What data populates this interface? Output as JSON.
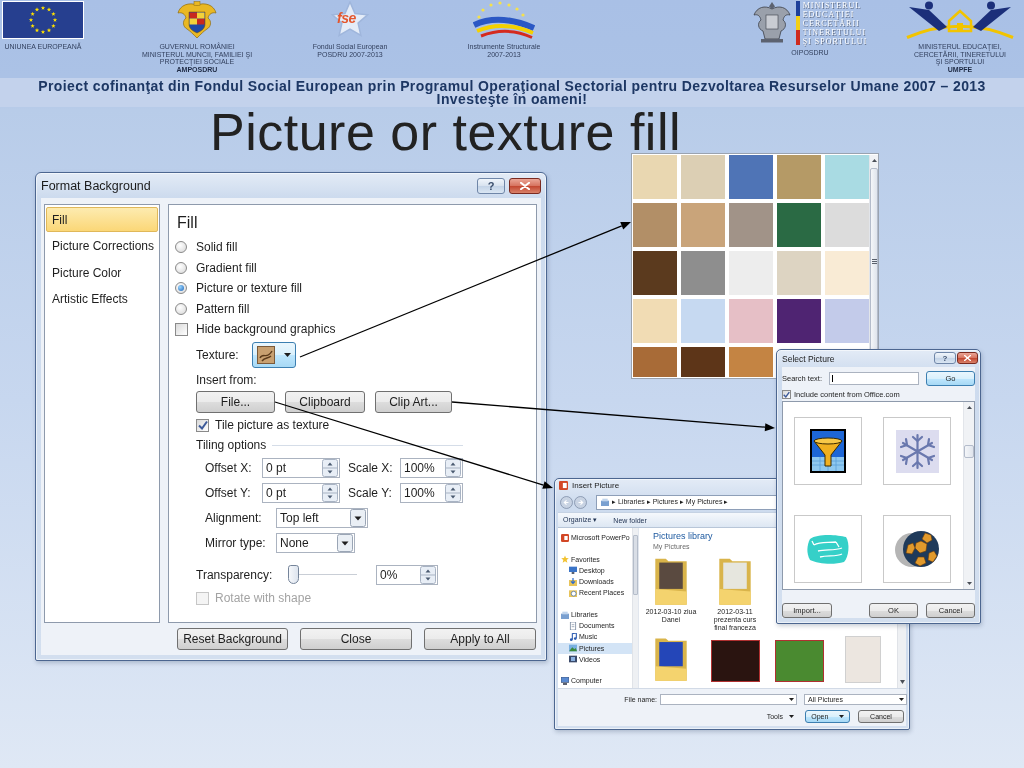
{
  "header": {
    "logos": [
      {
        "kind": "eu-flag",
        "caption": [
          "UNIUNEA EUROPEANĂ"
        ]
      },
      {
        "kind": "coat-of-arms",
        "caption": [
          "GUVERNUL ROMÂNIEI",
          "MINISTERUL MUNCII, FAMILIEI ŞI",
          "PROTECŢIEI SOCIALE",
          "**AMPOSDRU**"
        ]
      },
      {
        "kind": "fse-star",
        "mark": "fse",
        "caption": [
          "Fondul Social European",
          "POSDRU 2007-2013"
        ]
      },
      {
        "kind": "structural-instruments",
        "caption": [
          "Instrumente Structurale",
          "2007-2013"
        ]
      },
      {
        "kind": "ministry-eagle",
        "mark_lines": [
          "MINISTERUL",
          "EDUCAŢIEI",
          "CERCETĂRII",
          "TINERETULUI",
          "ŞI SPORTULUI"
        ],
        "caption": [
          "OIPOSDRU"
        ]
      },
      {
        "kind": "umpfe-house",
        "caption": [
          "MINISTERUL EDUCAŢIEI,",
          "CERCETĂRII, TINERETULUI",
          "ŞI SPORTULUI",
          "**UMPFE**"
        ]
      }
    ]
  },
  "banner": {
    "text": "Proiect cofinanţat din Fondul Social European prin Programul Operaţional Sectorial pentru Dezvoltarea Resurselor Umane 2007 – 2013",
    "slogan": "Investeşte în oameni!"
  },
  "title": "Picture or texture fill",
  "format_background": {
    "title": "Format Background",
    "help": "?",
    "categories": [
      {
        "label": "Fill",
        "selected": true
      },
      {
        "label": "Picture Corrections",
        "selected": false
      },
      {
        "label": "Picture Color",
        "selected": false
      },
      {
        "label": "Artistic Effects",
        "selected": false
      }
    ],
    "heading": "Fill",
    "fill_options": [
      {
        "label": "Solid fill",
        "selected": false
      },
      {
        "label": "Gradient fill",
        "selected": false
      },
      {
        "label": "Picture or texture fill",
        "selected": true
      },
      {
        "label": "Pattern fill",
        "selected": false
      }
    ],
    "hide_background_graphics": {
      "label": "Hide background graphics",
      "checked": false
    },
    "texture": {
      "label": "Texture:"
    },
    "insert_from": {
      "label": "Insert from:",
      "buttons": [
        "File...",
        "Clipboard",
        "Clip Art..."
      ]
    },
    "tile_as_texture": {
      "label": "Tile picture as texture",
      "checked": true
    },
    "tiling_options": {
      "label": "Tiling options",
      "fields": [
        {
          "label": "Offset X:",
          "value": "0 pt"
        },
        {
          "label": "Scale X:",
          "value": "100%"
        },
        {
          "label": "Offset Y:",
          "value": "0 pt"
        },
        {
          "label": "Scale Y:",
          "value": "100%"
        }
      ],
      "dropdowns": [
        {
          "label": "Alignment:",
          "value": "Top left"
        },
        {
          "label": "Mirror type:",
          "value": "None"
        }
      ]
    },
    "transparency": {
      "label": "Transparency:",
      "level": 0,
      "value": "0%"
    },
    "rotate_with_shape": {
      "label": "Rotate with shape",
      "checked": false,
      "disabled": true
    },
    "buttons": [
      "Reset Background",
      "Close",
      "Apply to All"
    ]
  },
  "texture_gallery": {
    "tiles": [
      {
        "color": "#e9d7b1"
      },
      {
        "color": "#dccfb4"
      },
      {
        "color": "#4f74b6"
      },
      {
        "color": "#b59a66"
      },
      {
        "color": "#a9dbe3"
      },
      {
        "color": "#b28f67"
      },
      {
        "color": "#c9a47a"
      },
      {
        "color": "#a19388"
      },
      {
        "color": "#2a6a44"
      },
      {
        "color": "#dcdcdc"
      },
      {
        "color": "#5b3a1e"
      },
      {
        "color": "#8e8e8e"
      },
      {
        "color": "#ededed"
      },
      {
        "color": "#ddd4c2"
      },
      {
        "color": "#f9ebd5"
      },
      {
        "color": "#f1dcb4"
      },
      {
        "color": "#c6d9f1"
      },
      {
        "color": "#e6bfc6"
      },
      {
        "color": "#4f2472"
      },
      {
        "color": "#c3cbea"
      },
      {
        "color": "#a86b37"
      },
      {
        "color": "#5d3518"
      },
      {
        "color": "#c48443"
      }
    ]
  },
  "select_picture": {
    "title": "Select Picture",
    "help": "?",
    "search_label": "Search text:",
    "go_button": {
      "label": "Go",
      "default": true
    },
    "include_office": {
      "label": "Include content from Office.com",
      "checked": true
    },
    "clips": [
      {
        "kind": "funnel"
      },
      {
        "kind": "snowflake"
      },
      {
        "kind": "hand"
      },
      {
        "kind": "ball"
      }
    ],
    "buttons": [
      "Import...",
      "OK",
      "Cancel"
    ]
  },
  "insert_picture": {
    "title": "Insert Picture",
    "breadcrumb": "▸ Libraries ▸ Pictures ▸ My Pictures ▸",
    "toolbar": [
      "Organize ▾",
      "New folder"
    ],
    "nav": [
      {
        "label": "Microsoft PowerPo",
        "kind": "app",
        "selected": false
      },
      {
        "label": "Favorites",
        "kind": "favorites",
        "selected": false,
        "children": [
          {
            "label": "Desktop",
            "kind": "desktop",
            "selected": false
          },
          {
            "label": "Downloads",
            "kind": "downloads",
            "selected": false
          },
          {
            "label": "Recent Places",
            "kind": "recent",
            "selected": false
          }
        ]
      },
      {
        "label": "Libraries",
        "kind": "libraries",
        "selected": false,
        "children": [
          {
            "label": "Documents",
            "kind": "documents",
            "selected": false
          },
          {
            "label": "Music",
            "kind": "music",
            "selected": false
          },
          {
            "label": "Pictures",
            "kind": "pictures",
            "selected": true
          },
          {
            "label": "Videos",
            "kind": "videos",
            "selected": false
          }
        ]
      },
      {
        "label": "Computer",
        "kind": "computer",
        "selected": false
      }
    ],
    "library_title": "Pictures library",
    "library_subtitle": "My Pictures",
    "item_rows": [
      [
        {
          "kind": "folder",
          "color": "#5a4a40",
          "caption": "2012-03-10 ziua Danei"
        },
        {
          "kind": "folder",
          "color": "#e6e6de",
          "caption": "2012-03-11 prezenta curs final franceza"
        }
      ],
      [
        {
          "kind": "folder",
          "color": "#2446b8"
        },
        {
          "kind": "photo",
          "color": "#2a1410"
        },
        {
          "kind": "photo",
          "color": "#4a8a30"
        },
        {
          "kind": "portrait-photo",
          "color": "#ece6e0"
        }
      ]
    ],
    "file_name_label": "File name:",
    "filter": "All Pictures",
    "tools": "Tools",
    "buttons": [
      {
        "label": "Open",
        "default": true
      },
      {
        "label": "Cancel",
        "default": false
      }
    ]
  }
}
